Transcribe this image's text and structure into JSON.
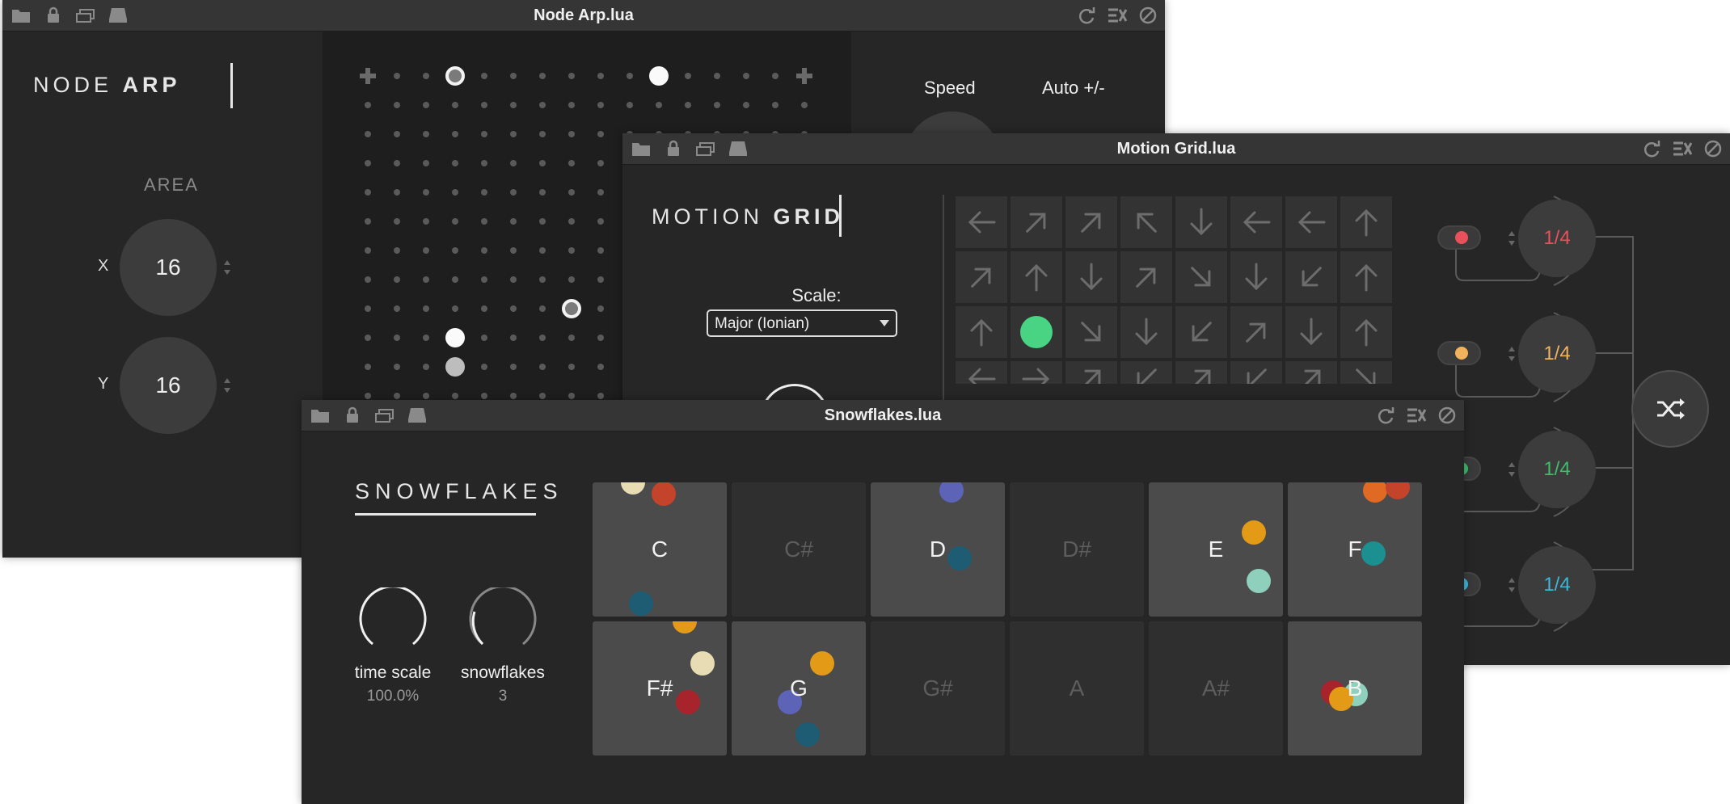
{
  "node_arp": {
    "title": "Node Arp.lua",
    "brand_light": "NODE ",
    "brand_bold": "ARP",
    "area_label": "AREA",
    "x_label": "X",
    "x_value": "16",
    "y_label": "Y",
    "y_value": "16",
    "speed_label": "Speed",
    "auto_label": "Auto +/-"
  },
  "motion_grid": {
    "title": "Motion Grid.lua",
    "brand_light": "MOTION ",
    "brand_bold": "GRID",
    "scale_label": "Scale:",
    "scale_value": "Major (Ionian)",
    "rows": [
      [
        "left",
        "ne",
        "ne",
        "nw",
        "down",
        "left",
        "left",
        "up"
      ],
      [
        "ne",
        "up",
        "down",
        "ne",
        "se",
        "down",
        "sw",
        "up"
      ],
      [
        "up",
        "dot",
        "se",
        "down",
        "sw",
        "ne",
        "down",
        "up"
      ],
      [
        "left",
        "right",
        "ne",
        "sw",
        "ne",
        "sw",
        "ne",
        "se"
      ]
    ],
    "lanes": [
      {
        "value": "1/4",
        "color": "#e8505b"
      },
      {
        "value": "1/4",
        "color": "#f2b25c"
      },
      {
        "value": "1/4",
        "color": "#3dbd6a"
      },
      {
        "value": "1/4",
        "color": "#3cb6d9"
      }
    ],
    "active_color": "#48d483"
  },
  "snowflakes": {
    "title": "Snowflakes.lua",
    "brand": "SNOWFLAKES",
    "time_scale_label": "time scale",
    "time_scale_value": "100.0%",
    "snowflakes_label": "snowflakes",
    "snowflakes_value": "3",
    "notes_row1": [
      {
        "name": "C",
        "lit": true
      },
      {
        "name": "C#",
        "lit": false
      },
      {
        "name": "D",
        "lit": true
      },
      {
        "name": "D#",
        "lit": false
      },
      {
        "name": "E",
        "lit": true
      },
      {
        "name": "F",
        "lit": true
      }
    ],
    "notes_row2": [
      {
        "name": "F#",
        "lit": true
      },
      {
        "name": "G",
        "lit": true
      },
      {
        "name": "G#",
        "lit": false
      },
      {
        "name": "A",
        "lit": false
      },
      {
        "name": "A#",
        "lit": false
      },
      {
        "name": "B",
        "lit": true
      }
    ]
  }
}
